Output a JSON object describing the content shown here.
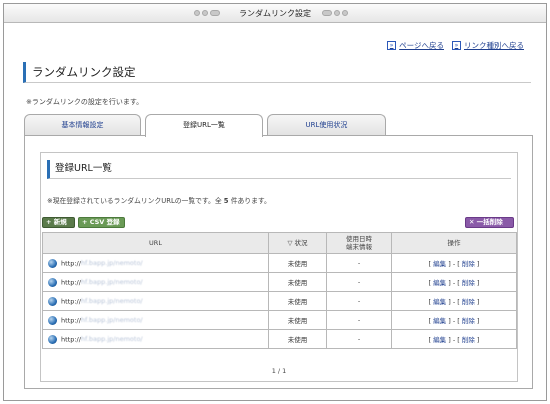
{
  "window": {
    "title": "ランダムリンク設定"
  },
  "toplinks": {
    "back_label": "ページへ戻る",
    "types_label": "リンク種別へ戻る"
  },
  "heading": "ランダムリンク設定",
  "description": "※ランダムリンクの設定を行います。",
  "tabs": [
    {
      "label": "基本情報設定"
    },
    {
      "label": "登録URL一覧"
    },
    {
      "label": "URL使用状況"
    }
  ],
  "section": {
    "title": "登録URL一覧",
    "desc_prefix": "※現在登録されているランダムリンクURLの一覧です。全",
    "count": "5",
    "desc_suffix": "件あります。"
  },
  "buttons": {
    "new": "+ 新規",
    "csv": "+ CSV 登録",
    "delete_all": "✕ 一括削除"
  },
  "table": {
    "headers": {
      "url": "URL",
      "status": "▽ 状況",
      "used_line1": "使用日時",
      "used_line2": "端末情報",
      "ops": "操作"
    },
    "rows": [
      {
        "url_prefix": "http://",
        "url_rest": "hf.bapp.jp/nemoto/",
        "status": "未使用",
        "used": "-",
        "edit": "編集",
        "delete": "削除"
      },
      {
        "url_prefix": "http://",
        "url_rest": "hf.bapp.jp/nemoto/",
        "status": "未使用",
        "used": "-",
        "edit": "編集",
        "delete": "削除"
      },
      {
        "url_prefix": "http://",
        "url_rest": "hf.bapp.jp/nemoto/",
        "status": "未使用",
        "used": "-",
        "edit": "編集",
        "delete": "削除"
      },
      {
        "url_prefix": "http://",
        "url_rest": "hf.bapp.jp/nemoto/",
        "status": "未使用",
        "used": "-",
        "edit": "編集",
        "delete": "削除"
      },
      {
        "url_prefix": "http://",
        "url_rest": "hf.bapp.jp/nemoto/",
        "status": "未使用",
        "used": "-",
        "edit": "編集",
        "delete": "削除"
      }
    ]
  },
  "pager": "1 / 1"
}
